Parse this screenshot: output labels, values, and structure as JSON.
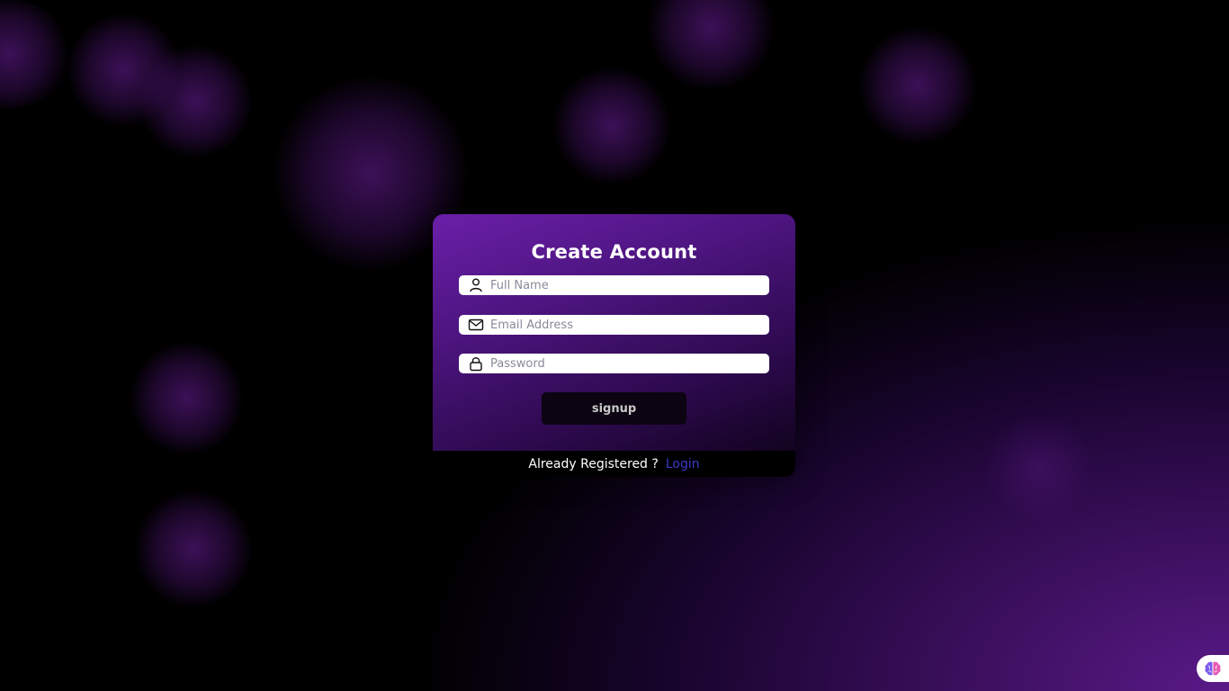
{
  "form": {
    "title": "Create Account",
    "fields": [
      {
        "icon": "user-icon",
        "placeholder": "Full Name",
        "value": ""
      },
      {
        "icon": "mail-icon",
        "placeholder": "Email Address",
        "value": ""
      },
      {
        "icon": "lock-icon",
        "placeholder": "Password",
        "value": ""
      }
    ],
    "submit_label": "signup"
  },
  "footer": {
    "text": "Already Registered ?",
    "link_label": "Login"
  },
  "corner_badge": {
    "icon": "brain-icon"
  },
  "colors": {
    "card_gradient_start": "#6a1fa8",
    "card_gradient_end": "#12031f",
    "background_glow": "#5a1a88",
    "link": "#3a3ac8",
    "button_bg": "#0c0412"
  }
}
